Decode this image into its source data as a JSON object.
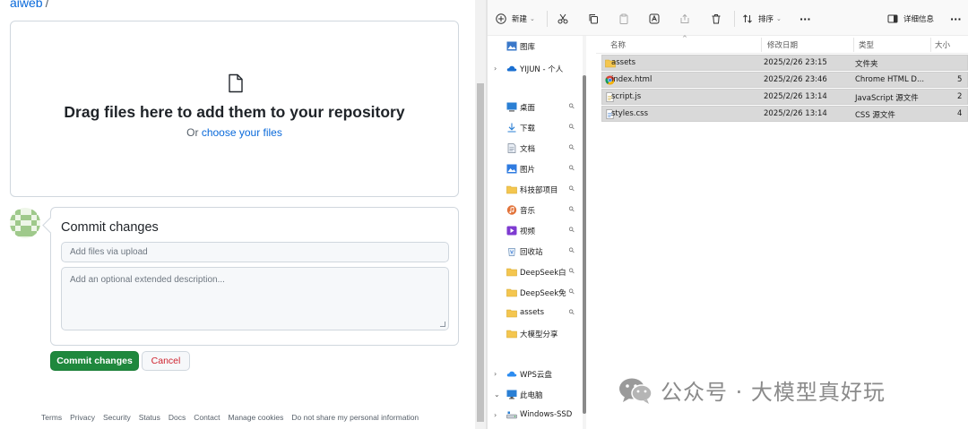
{
  "github": {
    "breadcrumb": "aiweb",
    "breadcrumb_sep": "/",
    "dropzone": {
      "title": "Drag files here to add them to your repository",
      "sub_prefix": "Or",
      "sub_link": "choose your files"
    },
    "commit": {
      "title": "Commit changes",
      "summary_placeholder": "Add files via upload",
      "description_placeholder": "Add an optional extended description...",
      "commit_button": "Commit changes",
      "cancel_button": "Cancel"
    },
    "footer": [
      "Terms",
      "Privacy",
      "Security",
      "Status",
      "Docs",
      "Contact",
      "Manage cookies",
      "Do not share my personal information"
    ],
    "colors": {
      "link": "#0969da",
      "primary_button": "#1f883d",
      "cancel_text": "#cf222e"
    }
  },
  "explorer": {
    "toolbar": {
      "new": "新建",
      "sort": "排序",
      "details": "详细信息",
      "more": "···"
    },
    "nav": [
      {
        "label": "图库",
        "icon": "gallery-icon",
        "chevron": "",
        "pin": false
      },
      {
        "label": "YIJUN - 个人",
        "icon": "onedrive-cloud-icon",
        "chevron": "›",
        "pin": false
      },
      {
        "label": "桌面",
        "icon": "desktop-icon",
        "chevron": "",
        "pin": true
      },
      {
        "label": "下载",
        "icon": "download-icon",
        "chevron": "",
        "pin": true
      },
      {
        "label": "文档",
        "icon": "document-icon",
        "chevron": "",
        "pin": true
      },
      {
        "label": "图片",
        "icon": "pictures-icon",
        "chevron": "",
        "pin": true
      },
      {
        "label": "科技部项目",
        "icon": "folder-icon",
        "chevron": "",
        "pin": true
      },
      {
        "label": "音乐",
        "icon": "music-icon",
        "chevron": "",
        "pin": true
      },
      {
        "label": "视频",
        "icon": "video-icon",
        "chevron": "",
        "pin": true
      },
      {
        "label": "回收站",
        "icon": "recycle-bin-icon",
        "chevron": "",
        "pin": true
      },
      {
        "label": "DeepSeek白",
        "icon": "folder-icon",
        "chevron": "",
        "pin": true
      },
      {
        "label": "DeepSeek免",
        "icon": "folder-icon",
        "chevron": "",
        "pin": true
      },
      {
        "label": "assets",
        "icon": "folder-icon",
        "chevron": "",
        "pin": true
      },
      {
        "label": "大模型分享",
        "icon": "folder-icon",
        "chevron": "",
        "pin": false
      },
      {
        "label": "WPS云盘",
        "icon": "wps-cloud-icon",
        "chevron": "›",
        "pin": false
      },
      {
        "label": "此电脑",
        "icon": "this-pc-icon",
        "chevron": "⌄",
        "pin": false
      },
      {
        "label": "Windows-SSD",
        "icon": "drive-icon",
        "chevron": "›",
        "pin": false
      }
    ],
    "pin_glyph": "📌",
    "columns": [
      "名称",
      "修改日期",
      "类型",
      "大小"
    ],
    "sort_caret": "^",
    "files": [
      {
        "name": "assets",
        "modified": "2025/2/26 23:15",
        "type": "文件夹",
        "size": "",
        "icon": "folder-icon"
      },
      {
        "name": "index.html",
        "modified": "2025/2/26 23:46",
        "type": "Chrome HTML D...",
        "size": "5",
        "icon": "chrome-icon"
      },
      {
        "name": "script.js",
        "modified": "2025/2/26 13:14",
        "type": "JavaScript 源文件",
        "size": "2",
        "icon": "js-file-icon"
      },
      {
        "name": "styles.css",
        "modified": "2025/2/26 13:14",
        "type": "CSS 源文件",
        "size": "4",
        "icon": "css-file-icon"
      }
    ]
  },
  "watermark": {
    "text": "公众号 · 大模型真好玩",
    "icon": "wechat-icon"
  }
}
